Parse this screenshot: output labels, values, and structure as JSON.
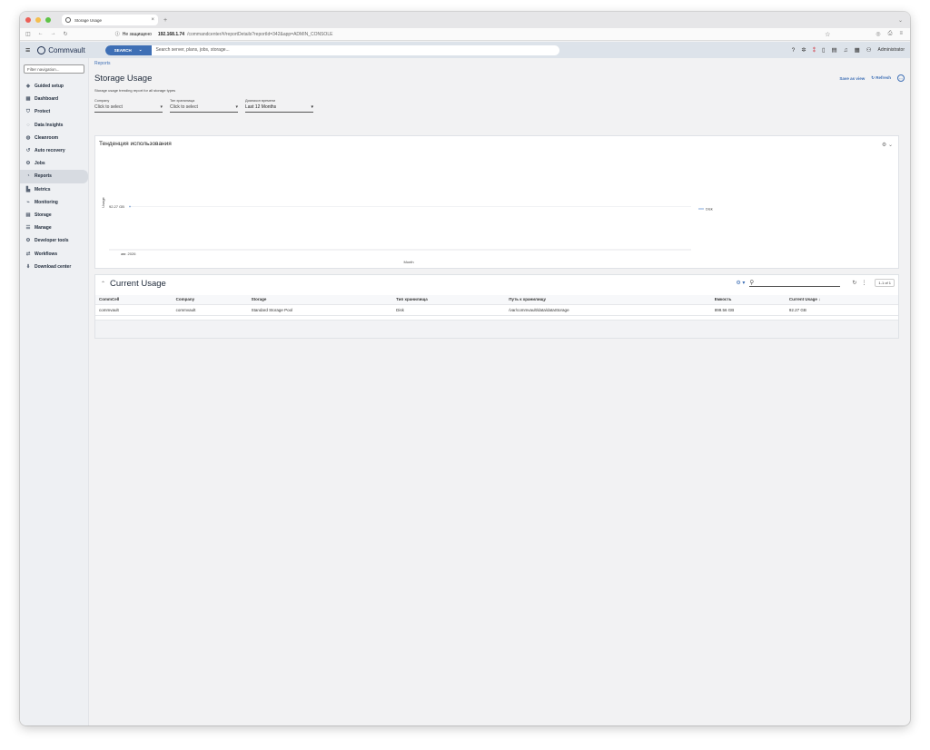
{
  "browser": {
    "tab_title": "Storage Usage",
    "security_label": "Не защищено",
    "url_host": "192.168.1.74",
    "url_path": "/commandcenter/#/reportDetails?reportId=342&app=ADMIN_CONSOLE"
  },
  "header": {
    "brand": "Commvault",
    "search_button": "SEARCH",
    "search_placeholder": "Search server, plans, jobs, storage...",
    "user": "Administrator"
  },
  "sidebar": {
    "filter_placeholder": "Filter navigation...",
    "items": [
      {
        "label": "Guided setup",
        "icon": "guided-setup-icon"
      },
      {
        "label": "Dashboard",
        "icon": "dashboard-icon"
      },
      {
        "label": "Protect",
        "icon": "protect-icon"
      },
      {
        "label": "Data Insights",
        "icon": "data-insights-icon"
      },
      {
        "label": "Cleanroom",
        "icon": "cleanroom-icon"
      },
      {
        "label": "Auto recovery",
        "icon": "auto-recovery-icon"
      },
      {
        "label": "Jobs",
        "icon": "jobs-icon"
      },
      {
        "label": "Reports",
        "icon": "reports-icon",
        "active": true
      },
      {
        "label": "Metrics",
        "icon": "metrics-icon"
      },
      {
        "label": "Monitoring",
        "icon": "monitoring-icon"
      },
      {
        "label": "Storage",
        "icon": "storage-icon"
      },
      {
        "label": "Manage",
        "icon": "manage-icon"
      },
      {
        "label": "Developer tools",
        "icon": "developer-tools-icon"
      },
      {
        "label": "Workflows",
        "icon": "workflows-icon"
      },
      {
        "label": "Download center",
        "icon": "download-center-icon"
      }
    ]
  },
  "page": {
    "breadcrumb": "Reports",
    "title": "Storage Usage",
    "description": "Storage usage trending report for all storage types",
    "save_as_view": "Save as view",
    "refresh": "Refresh",
    "filters": [
      {
        "label": "Company",
        "value": "Click to select"
      },
      {
        "label": "Тип хранилища",
        "value": "Click to select"
      },
      {
        "label": "Диапазон времени",
        "value": "Last 12 Months"
      }
    ]
  },
  "chart_data": {
    "type": "line",
    "title": "Тенденция использования",
    "xlabel": "Month",
    "ylabel": "Usage",
    "x": [
      "авг. 2026"
    ],
    "series": [
      {
        "name": "Disk",
        "values": [
          92.27
        ],
        "color": "#7fa6d8"
      }
    ],
    "ytick_labels": [
      "92.27 GB"
    ],
    "legend_position": "right",
    "grid": true
  },
  "usage": {
    "title": "Current Usage",
    "pager": "1-1 of 1",
    "columns": [
      "CommCell",
      "Company",
      "Storage",
      "Тип хранилища",
      "Путь к хранилищу",
      "Емкость",
      "Current Usage ↓"
    ],
    "rows": [
      [
        "commvault",
        "commvault",
        "Standard Storage Pool",
        "Disk",
        "/var/commvault/data/dataStorage",
        "899.56 GB",
        "92.27 GB"
      ]
    ]
  },
  "colors": {
    "accent": "#3e6fb5",
    "alert": "#d0313d"
  }
}
